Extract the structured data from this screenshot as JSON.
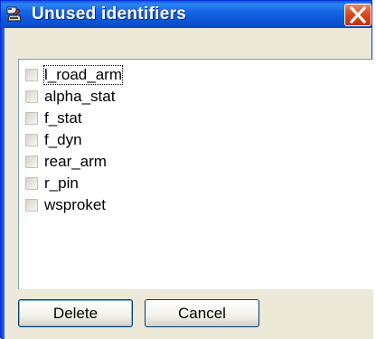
{
  "window": {
    "title": "Unused identifiers"
  },
  "icons": {
    "app": "app-icon",
    "close": "close-icon",
    "checkbox": "checkbox"
  },
  "list": {
    "items": [
      {
        "label": "l_road_arm",
        "checked": false,
        "focused": true
      },
      {
        "label": "alpha_stat",
        "checked": false
      },
      {
        "label": "f_stat",
        "checked": false
      },
      {
        "label": "f_dyn",
        "checked": false
      },
      {
        "label": "rear_arm",
        "checked": false
      },
      {
        "label": "r_pin",
        "checked": false
      },
      {
        "label": "wsproket",
        "checked": false
      }
    ]
  },
  "buttons": {
    "delete_label": "Delete",
    "cancel_label": "Cancel"
  },
  "colors": {
    "titlebar": "#0a53d2",
    "close": "#d94a1f",
    "face": "#ece9d8",
    "accent": "#003c74"
  }
}
